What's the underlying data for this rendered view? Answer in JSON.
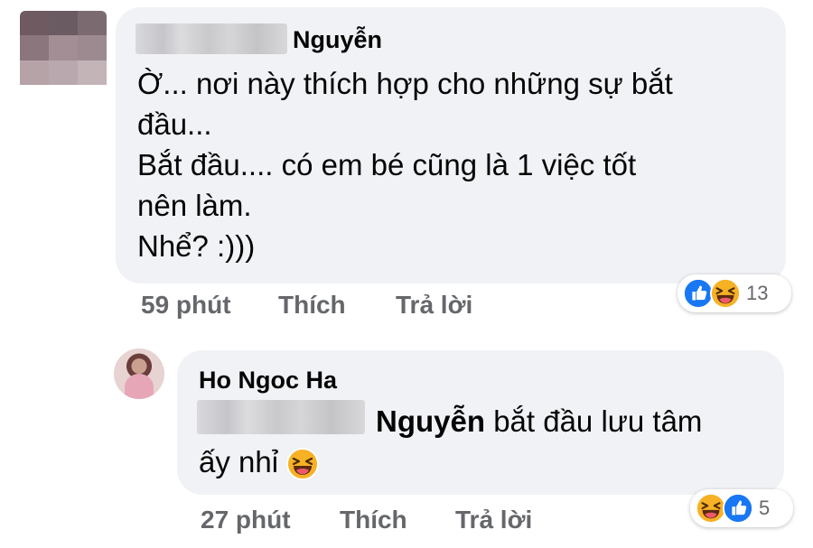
{
  "comment": {
    "author_name": "Nguyễn",
    "lines": [
      "Ờ... nơi này thích hợp cho những sự bắt",
      "đầu...",
      "Bắt đầu.... có em bé cũng là 1 việc tốt",
      "nên làm.",
      "Nhể? :)))"
    ],
    "time": "59 phút",
    "like_label": "Thích",
    "reply_label": "Trả lời",
    "reaction_icons": [
      "like-icon",
      "laughing-emoji-icon"
    ],
    "reaction_count": "13"
  },
  "reply": {
    "author_name": "Ho Ngoc Ha",
    "mention_name": "Nguyễn",
    "text_part1": "bắt đầu lưu tâm",
    "text_part2": "ấy nhỉ",
    "inline_emoji": "laughing-emoji-icon",
    "time": "27 phút",
    "like_label": "Thích",
    "reply_label": "Trả lời",
    "reaction_icons": [
      "laughing-emoji-icon",
      "like-icon"
    ],
    "reaction_count": "5"
  },
  "colors": {
    "bubble_bg": "#f0f2f5",
    "meta_text": "#65676b",
    "like_blue": "#1877f2",
    "haha_yellow": "#f7b125"
  }
}
